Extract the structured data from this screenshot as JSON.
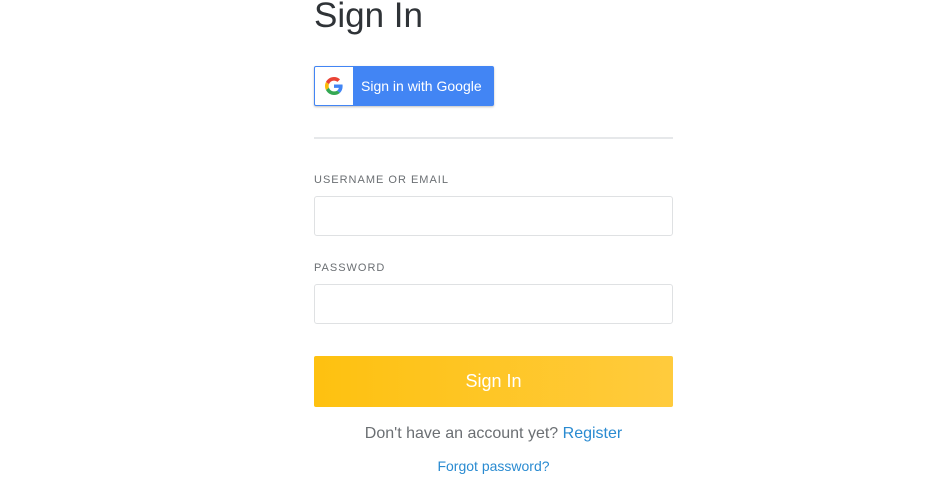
{
  "header": {
    "title": "Sign In"
  },
  "google": {
    "label": "Sign in with Google",
    "icon": "google-g-icon",
    "color": "#4285f4"
  },
  "form": {
    "username_label": "USERNAME OR EMAIL",
    "username_value": "",
    "password_label": "PASSWORD",
    "password_value": "",
    "submit_label": "Sign In",
    "submit_color": "#fec110"
  },
  "footer": {
    "register_prompt": "Don't have an account yet?",
    "register_link": "Register",
    "forgot_link": "Forgot password?",
    "link_color": "#2a8bd1"
  }
}
